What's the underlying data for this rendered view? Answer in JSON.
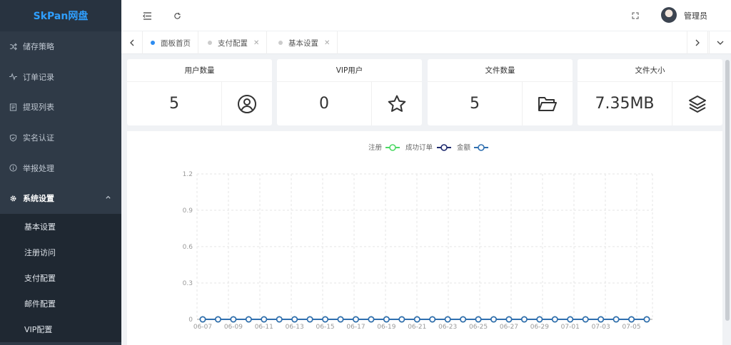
{
  "sidebar": {
    "logo": "SkPan网盘",
    "items": [
      {
        "label": "储存策略",
        "icon": "shuffle-icon"
      },
      {
        "label": "订单记录",
        "icon": "pulse-icon"
      },
      {
        "label": "提现列表",
        "icon": "list-icon"
      },
      {
        "label": "实名认证",
        "icon": "shield-check-icon"
      },
      {
        "label": "举报处理",
        "icon": "info-circle-icon"
      },
      {
        "label": "系统设置",
        "icon": "gear-icon"
      }
    ],
    "submenu": [
      "基本设置",
      "注册访问",
      "支付配置",
      "邮件配置",
      "VIP配置"
    ]
  },
  "header": {
    "username": "管理员"
  },
  "tabs": [
    {
      "label": "面板首页",
      "active": true,
      "closable": false
    },
    {
      "label": "支付配置",
      "active": false,
      "closable": true
    },
    {
      "label": "基本设置",
      "active": false,
      "closable": true
    }
  ],
  "cards": [
    {
      "title": "用户数量",
      "value": "5",
      "icon": "user-circle-icon"
    },
    {
      "title": "VIP用户",
      "value": "0",
      "icon": "star-icon"
    },
    {
      "title": "文件数量",
      "value": "5",
      "icon": "folder-open-icon"
    },
    {
      "title": "文件大小",
      "value": "7.35MB",
      "icon": "layers-icon"
    }
  ],
  "colors": {
    "register": "#4cd964",
    "orders": "#1e2a6e",
    "amount": "#2f6fb0",
    "accent": "#2d8cf0"
  },
  "chart_data": {
    "type": "line",
    "legend": [
      "注册",
      "成功订单",
      "金额"
    ],
    "legend_position": "top-center",
    "ylim": [
      0,
      1.2
    ],
    "yticks": [
      "0",
      "0.3",
      "0.6",
      "0.9",
      "1.2"
    ],
    "x": [
      "06-07",
      "06-08",
      "06-09",
      "06-10",
      "06-11",
      "06-12",
      "06-13",
      "06-14",
      "06-15",
      "06-16",
      "06-17",
      "06-18",
      "06-19",
      "06-20",
      "06-21",
      "06-22",
      "06-23",
      "06-24",
      "06-25",
      "06-26",
      "06-27",
      "06-28",
      "06-29",
      "06-30",
      "07-01",
      "07-02",
      "07-03",
      "07-04",
      "07-05",
      "07-06"
    ],
    "series": [
      {
        "name": "注册",
        "values": [
          0,
          0,
          0,
          0,
          0,
          0,
          0,
          0,
          0,
          0,
          0,
          0,
          0,
          0,
          0,
          0,
          0,
          0,
          0,
          0,
          0,
          0,
          0,
          0,
          0,
          0,
          0,
          0,
          0,
          0
        ]
      },
      {
        "name": "成功订单",
        "values": [
          0,
          0,
          0,
          0,
          0,
          0,
          0,
          0,
          0,
          0,
          0,
          0,
          0,
          0,
          0,
          0,
          0,
          0,
          0,
          0,
          0,
          0,
          0,
          0,
          0,
          0,
          0,
          0,
          0,
          0
        ]
      },
      {
        "name": "金额",
        "values": [
          0,
          0,
          0,
          0,
          0,
          0,
          0,
          0,
          0,
          0,
          0,
          0,
          0,
          0,
          0,
          0,
          0,
          0,
          0,
          0,
          0,
          0,
          0,
          0,
          0,
          0,
          0,
          0,
          0,
          0
        ]
      }
    ],
    "grid": true
  }
}
